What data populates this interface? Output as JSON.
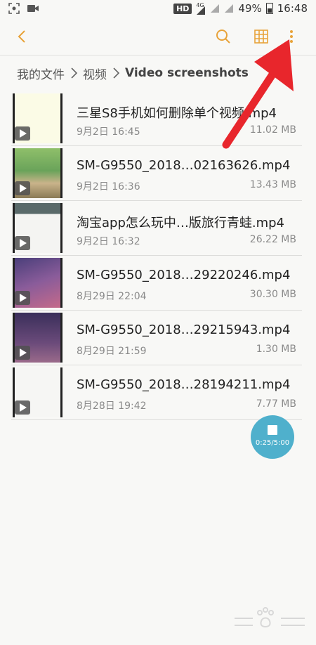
{
  "status_bar": {
    "hd": "HD",
    "network": "4G",
    "battery": "49%",
    "time": "16:48"
  },
  "breadcrumb": {
    "items": [
      "我的文件",
      "视频",
      "Video screenshots"
    ]
  },
  "files": [
    {
      "name": "三星S8手机如何删除单个视频.mp4",
      "date": "9月2日 16:45",
      "size": "11.02 MB"
    },
    {
      "name": "SM-G9550_2018…02163626.mp4",
      "date": "9月2日 16:36",
      "size": "13.43 MB"
    },
    {
      "name": "淘宝app怎么玩中…版旅行青蛙.mp4",
      "date": "9月2日 16:32",
      "size": "26.22 MB"
    },
    {
      "name": "SM-G9550_2018…29220246.mp4",
      "date": "8月29日 22:04",
      "size": "30.30 MB"
    },
    {
      "name": "SM-G9550_2018…29215943.mp4",
      "date": "8月29日 21:59",
      "size": "1.30 MB"
    },
    {
      "name": "SM-G9550_2018…28194211.mp4",
      "date": "8月28日 19:42",
      "size": "7.77 MB"
    }
  ],
  "recording": {
    "time": "0:25/5:00"
  },
  "colors": {
    "accent": "#e8a33a",
    "annotation": "#e8262c",
    "record_fab": "#4fb0cc"
  },
  "icons": {
    "back": "chevron-left-icon",
    "search": "search-icon",
    "grid": "grid-view-icon",
    "more": "more-vertical-icon"
  }
}
